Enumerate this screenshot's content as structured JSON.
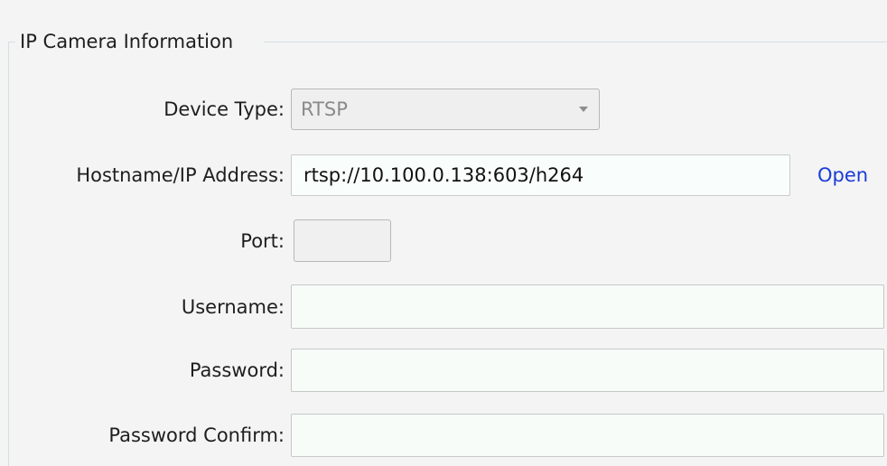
{
  "group": {
    "title": "IP Camera Information"
  },
  "device_type": {
    "label": "Device Type:",
    "selected": "RTSP",
    "icon": "chevron-down-icon"
  },
  "hostname": {
    "label": "Hostname/IP Address:",
    "value": "rtsp://10.100.0.138:603/h264",
    "open_label": "Open"
  },
  "port": {
    "label": "Port:",
    "value": ""
  },
  "username": {
    "label": "Username:",
    "value": ""
  },
  "password": {
    "label": "Password:",
    "value": ""
  },
  "password_confirm": {
    "label": "Password Confirm:",
    "value": ""
  },
  "colors": {
    "link": "#1a3cd8",
    "field_background": "#f7fcf9",
    "disabled_text": "#8a8a8a"
  }
}
